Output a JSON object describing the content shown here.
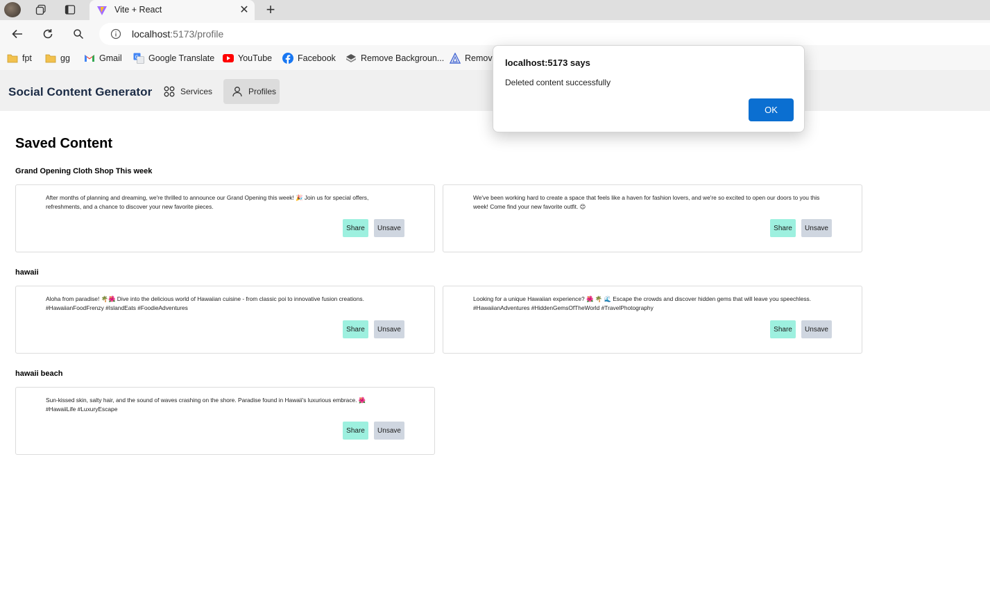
{
  "browser": {
    "tab_title": "Vite + React",
    "url_host": "localhost",
    "url_path": ":5173/profile",
    "bookmarks": [
      {
        "label": "fpt",
        "icon": "folder-icon"
      },
      {
        "label": "gg",
        "icon": "folder-icon"
      },
      {
        "label": "Gmail",
        "icon": "gmail-icon"
      },
      {
        "label": "Google Translate",
        "icon": "translate-icon"
      },
      {
        "label": "YouTube",
        "icon": "youtube-icon"
      },
      {
        "label": "Facebook",
        "icon": "facebook-icon"
      },
      {
        "label": "Remove Backgroun...",
        "icon": "remove-bg-icon"
      },
      {
        "label": "Remov",
        "icon": "remove-icon"
      }
    ]
  },
  "app": {
    "brand": "Social Content Generator",
    "nav": [
      {
        "label": "Services",
        "icon": "grid-icon"
      },
      {
        "label": "Profiles",
        "icon": "user-icon",
        "active": true
      }
    ]
  },
  "page": {
    "title": "Saved Content",
    "share_label": "Share",
    "unsave_label": "Unsave",
    "groups": [
      {
        "title": "Grand Opening Cloth Shop This week",
        "items": [
          "After months of planning and dreaming, we're thrilled to announce our Grand Opening this week! 🎉 Join us for special offers, refreshments, and a chance to discover your new favorite pieces.",
          "We've been working hard to create a space that feels like a haven for fashion lovers, and we're so excited to open our doors to you this week! Come find your new favorite outfit. 😊"
        ]
      },
      {
        "title": "hawaii",
        "items": [
          "Aloha from paradise! 🌴🌺 Dive into the delicious world of Hawaiian cuisine - from classic poi to innovative fusion creations. #HawaiianFoodFrenzy #IslandEats #FoodieAdventures",
          "Looking for a unique Hawaiian experience? 🌺 🌴 🌊 Escape the crowds and discover hidden gems that will leave you speechless. #HawaiianAdventures #HiddenGemsOfTheWorld #TravelPhotography"
        ]
      },
      {
        "title": "hawaii beach",
        "items": [
          "Sun-kissed skin, salty hair, and the sound of waves crashing on the shore. Paradise found in Hawaii's luxurious embrace. 🌺 #HawaiiLife #LuxuryEscape"
        ]
      }
    ]
  },
  "dialog": {
    "title": "localhost:5173 says",
    "message": "Deleted content successfully",
    "ok_label": "OK"
  }
}
